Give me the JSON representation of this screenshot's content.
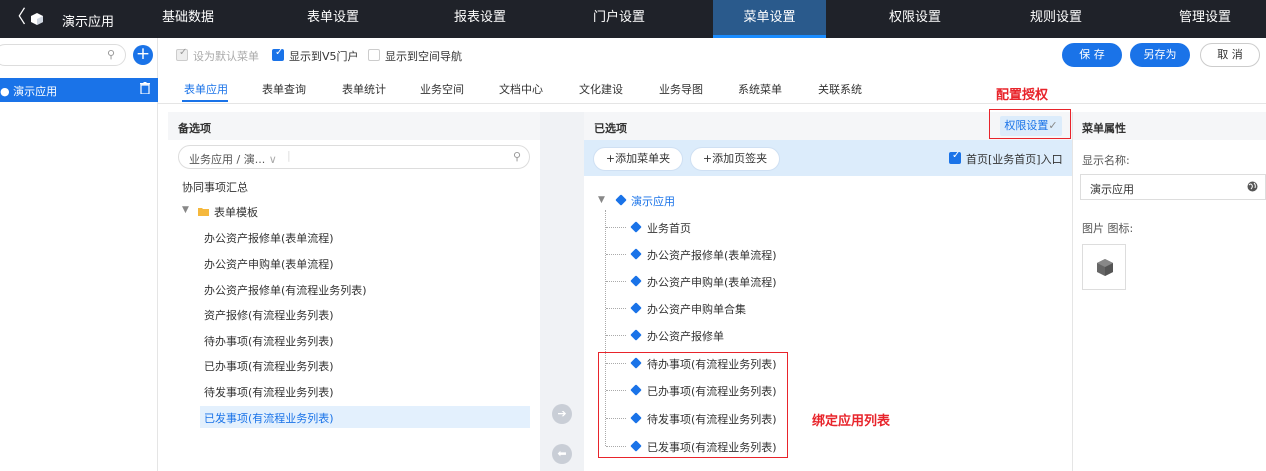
{
  "topbar": {
    "back_glyph": "〈",
    "app_title": "演示应用",
    "nav": [
      "基础数据",
      "表单设置",
      "报表设置",
      "门户设置",
      "菜单设置",
      "权限设置",
      "规则设置",
      "管理设置"
    ],
    "active_nav": "菜单设置"
  },
  "sidebar": {
    "add_glyph": "+",
    "search_glyph": "⚲",
    "selected_item": "演示应用"
  },
  "toolbar": {
    "checkbox_default_menu": "设为默认菜单",
    "checkbox_v5_portal": "显示到V5门户",
    "checkbox_space_nav": "显示到空间导航",
    "save": "保 存",
    "save_as": "另存为",
    "cancel": "取 消"
  },
  "tabs": [
    "表单应用",
    "表单查询",
    "表单统计",
    "业务空间",
    "文档中心",
    "文化建设",
    "业务导图",
    "系统菜单",
    "关联系统"
  ],
  "annotations": {
    "config_auth": "配置授权",
    "bind_list": "绑定应用列表"
  },
  "candidates": {
    "header": "备选项",
    "filter_value": "业务应用 / 演...",
    "filter_chevron": "∨",
    "group_label": "协同事项汇总",
    "folder_label": "表单模板",
    "items": [
      "办公资产报修单(表单流程)",
      "办公资产申购单(表单流程)",
      "办公资产报修单(有流程业务列表)",
      "资产报修(有流程业务列表)",
      "待办事项(有流程业务列表)",
      "已办事项(有流程业务列表)",
      "待发事项(有流程业务列表)",
      "已发事项(有流程业务列表)"
    ]
  },
  "transfer": {
    "right_arrow": "➔",
    "left_arrow": "⬅"
  },
  "selected": {
    "header": "已选项",
    "auth_button": "权限设置",
    "auth_check": "✓",
    "add_menu_folder": "+添加菜单夹",
    "add_tab_folder": "+添加页签夹",
    "homepage_entry": "首页[业务首页]入口",
    "root_label": "演示应用",
    "items": [
      "业务首页",
      "办公资产报修单(表单流程)",
      "办公资产申购单(表单流程)",
      "办公资产申购单合集",
      "办公资产报修单",
      "待办事项(有流程业务列表)",
      "已办事项(有流程业务列表)",
      "待发事项(有流程业务列表)",
      "已发事项(有流程业务列表)"
    ]
  },
  "properties": {
    "header": "菜单属性",
    "display_name_label": "显示名称:",
    "display_name_value": "演示应用",
    "icon_label": "图片 图标:"
  },
  "colors": {
    "topbar_bg": "#1f2229",
    "accent": "#1a73e8",
    "annotation_red": "#e8242b"
  }
}
